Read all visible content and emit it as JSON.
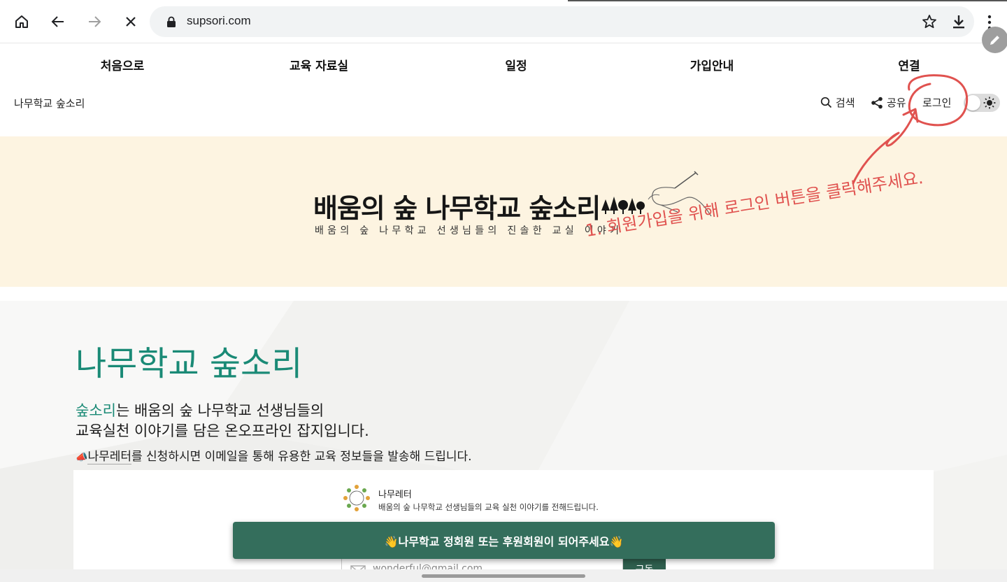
{
  "browser": {
    "url": "supsori.com",
    "icons": [
      "home-icon",
      "back-icon",
      "forward-icon",
      "close-icon",
      "lock-icon",
      "star-icon",
      "download-icon",
      "more-icon",
      "pen-icon"
    ]
  },
  "nav": {
    "items": [
      {
        "label": "처음으로"
      },
      {
        "label": "교육 자료실"
      },
      {
        "label": "일정"
      },
      {
        "label": "가입안내"
      },
      {
        "label": "연결"
      }
    ]
  },
  "subbar": {
    "site_name": "나무학교 숲소리",
    "search_label": "검색",
    "share_label": "공유",
    "login_label": "로그인"
  },
  "banner": {
    "title": "배움의 숲 나무학교 숲소리",
    "subtitle": "배움의 숲 나무학교 선생님들의 진솔한 교실 이야기",
    "colors": {
      "background": "#fdf4e1"
    }
  },
  "main": {
    "title": "나무학교 숲소리",
    "intro_accent": "숲소리",
    "intro_line1_rest": "는 배움의 숲 나무학교 선생님들의",
    "intro_line2": "교육실천 이야기를 담은 온오프라인 잡지입니다.",
    "intro_line3_icon": "📣",
    "intro_line3_link": "나무레터",
    "intro_line3_rest": "를 신청하시면 이메일을 통해 유용한 교육 정보들을 발송해 드립니다."
  },
  "newsletter": {
    "name": "나무레터",
    "description": "배움의 숲 나무학교 선생님들의 교육 실천 이야기를 전해드립니다.",
    "email_placeholder": "wonderful@gmail.com",
    "subscribe_label": "구독"
  },
  "toast": {
    "text": "👋나무학교 정회원 또는 후원회원이 되어주세요👋"
  },
  "annotation": {
    "text": "1. 회원가입을 위해 로그인 버튼을 클릭해주세요.",
    "color": "#e0524f"
  },
  "colors": {
    "accent": "#1a8a76",
    "toast_bg": "#346e5c"
  }
}
